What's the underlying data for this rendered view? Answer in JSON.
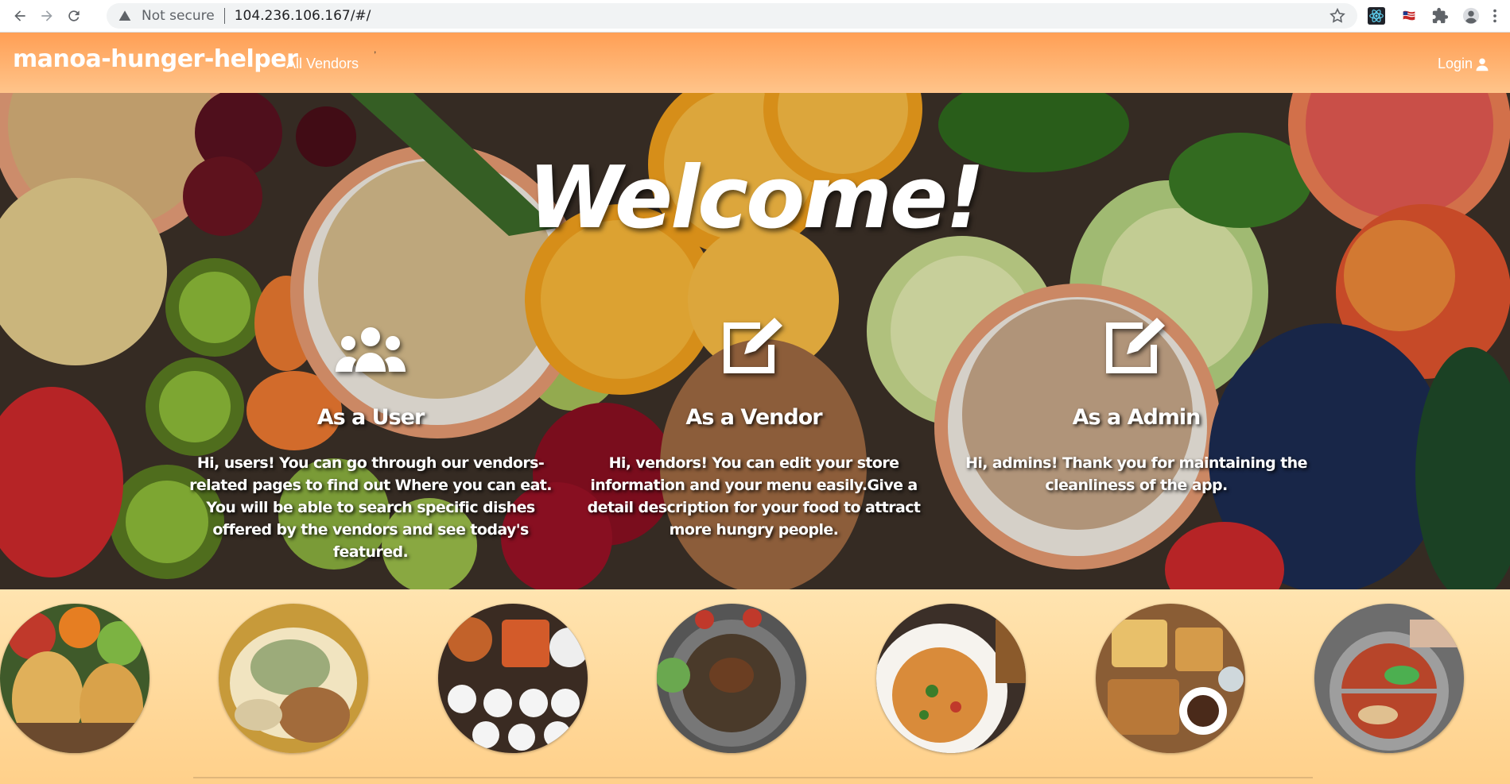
{
  "browser": {
    "security_label": "Not secure",
    "url": "104.236.106.167/#/",
    "icons": [
      "back-icon",
      "forward-icon",
      "reload-icon",
      "warning-icon",
      "star-icon",
      "react-devtools-icon",
      "flag-extension-icon",
      "puzzle-icon",
      "profile-icon",
      "menu-icon"
    ]
  },
  "navbar": {
    "brand": "manoa-hunger-helper",
    "links": [
      "All Vendors"
    ],
    "stray_mark": ",",
    "login_label": "Login"
  },
  "hero": {
    "title": "Welcome!",
    "roles": [
      {
        "icon": "users-icon",
        "heading": "As a User",
        "text": "Hi, users! You can go through our vendors-related pages to find out Where you can eat. You will be able to search specific dishes offered by the vendors and see today's featured."
      },
      {
        "icon": "edit-icon",
        "heading": "As a Vendor",
        "text": "Hi, vendors! You can edit your store information and your menu easily.Give a detail description for your food to attract more hungry people."
      },
      {
        "icon": "edit-icon",
        "heading": "As a Admin",
        "text": "Hi, admins! Thank you for maintaining the cleanliness of the app."
      }
    ]
  },
  "gallery": {
    "photos": [
      "egg waffles",
      "noodle dish",
      "korean banchan",
      "korean bbq",
      "pasta",
      "platter",
      "hot pot"
    ]
  },
  "colors": {
    "navbar_start": "#ff9f55",
    "navbar_end": "#ffc48a",
    "gallery_bg": "#ffd99c"
  }
}
